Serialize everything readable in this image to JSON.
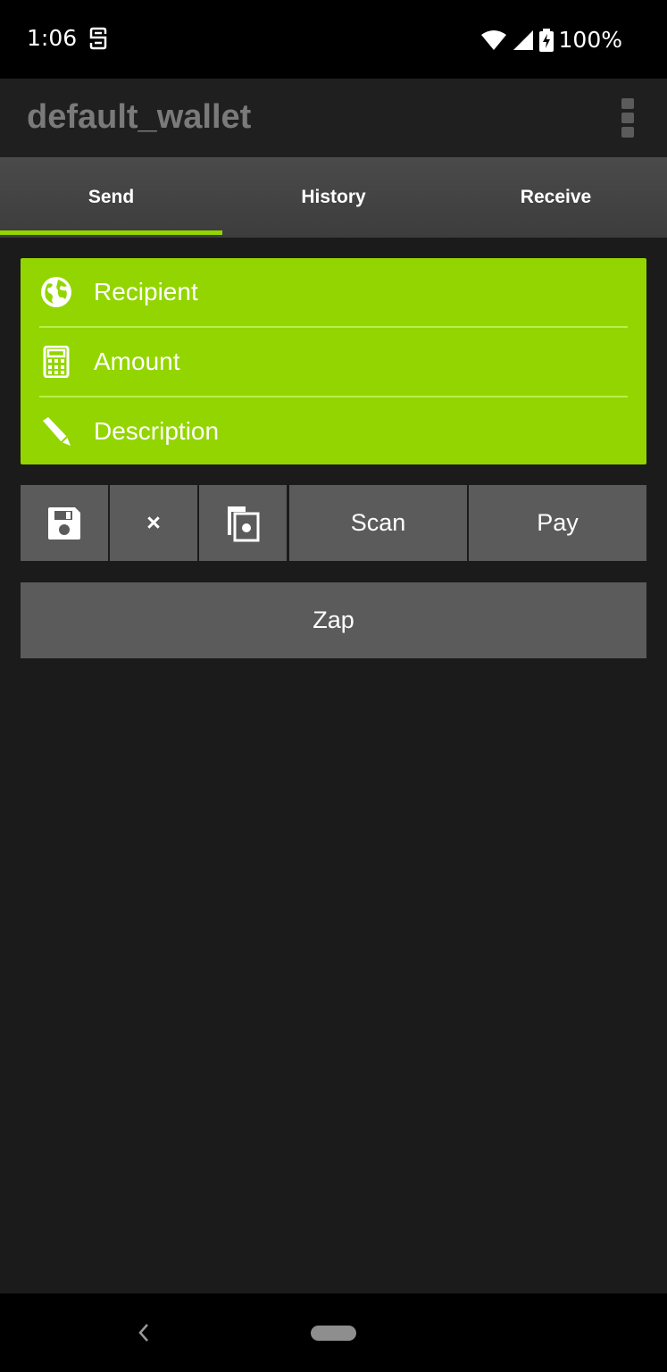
{
  "status_bar": {
    "time": "1:06",
    "battery": "100%"
  },
  "app_bar": {
    "title": "default_wallet"
  },
  "tabs": [
    {
      "label": "Send",
      "selected": true
    },
    {
      "label": "History",
      "selected": false
    },
    {
      "label": "Receive",
      "selected": false
    }
  ],
  "form": {
    "recipient_label": "Recipient",
    "amount_label": "Amount",
    "description_label": "Description"
  },
  "actions": {
    "clear_label": "×",
    "scan_label": "Scan",
    "pay_label": "Pay",
    "zap_label": "Zap"
  },
  "colors": {
    "accent": "#93d500",
    "button_bg": "#5b5b5b",
    "background": "#1b1b1b"
  },
  "icons": [
    "globe-icon",
    "calculator-icon",
    "pen-icon",
    "save-icon",
    "clear-icon",
    "paste-icon",
    "overflow-menu-icon",
    "back-icon",
    "home-icon"
  ]
}
